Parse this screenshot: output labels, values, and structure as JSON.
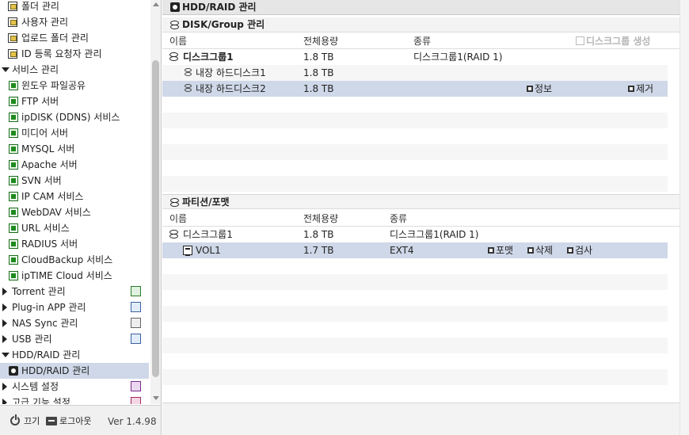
{
  "sidebar": {
    "items": [
      {
        "label": "폴더 관리",
        "icon": "folder-icon"
      },
      {
        "label": "사용자 관리",
        "icon": "folder-icon"
      },
      {
        "label": "업로드 폴더 관리",
        "icon": "folder-icon"
      },
      {
        "label": "ID 등록 요청자 관리",
        "icon": "folder-icon"
      },
      {
        "label": "서비스 관리",
        "icon": "expanded-arrow"
      },
      {
        "label": "윈도우 파일공유",
        "icon": "service-icon"
      },
      {
        "label": "FTP 서버",
        "icon": "service-icon"
      },
      {
        "label": "ipDISK (DDNS) 서비스",
        "icon": "service-icon"
      },
      {
        "label": "미디어 서버",
        "icon": "service-icon"
      },
      {
        "label": "MYSQL 서버",
        "icon": "service-icon"
      },
      {
        "label": "Apache 서버",
        "icon": "service-icon"
      },
      {
        "label": "SVN 서버",
        "icon": "service-icon"
      },
      {
        "label": "IP CAM 서비스",
        "icon": "service-icon"
      },
      {
        "label": "WebDAV 서비스",
        "icon": "service-icon"
      },
      {
        "label": "URL 서비스",
        "icon": "service-icon"
      },
      {
        "label": "RADIUS 서버",
        "icon": "service-icon"
      },
      {
        "label": "CloudBackup 서비스",
        "icon": "service-icon"
      },
      {
        "label": "ipTIME Cloud 서비스",
        "icon": "service-icon"
      },
      {
        "label": "Torrent 관리",
        "icon": "collapsed-arrow"
      },
      {
        "label": "Plug-in APP 관리",
        "icon": "collapsed-arrow"
      },
      {
        "label": "NAS Sync 관리",
        "icon": "collapsed-arrow"
      },
      {
        "label": "USB 관리",
        "icon": "collapsed-arrow"
      },
      {
        "label": "HDD/RAID 관리",
        "icon": "expanded-arrow"
      },
      {
        "label": "HDD/RAID 관리",
        "icon": "hdd-icon"
      },
      {
        "label": "시스템 설정",
        "icon": "collapsed-arrow"
      },
      {
        "label": "고급 기능 설정",
        "icon": "collapsed-arrow"
      }
    ],
    "footer": {
      "power_label": "끄기",
      "logout_label": "로그아웃",
      "version": "Ver 1.4.98"
    }
  },
  "main": {
    "title": "HDD/RAID 관리",
    "disk_panel": {
      "title": "DISK/Group 관리",
      "create_label": "디스크그룹 생성",
      "columns": [
        "이름",
        "전체용량",
        "종류"
      ],
      "rows": [
        {
          "name": "디스크그룹1",
          "capacity": "1.8 TB",
          "type": "디스크그룹1(RAID 1)"
        },
        {
          "name": "내장 하드디스크1",
          "capacity": "1.8 TB",
          "type": ""
        },
        {
          "name": "내장 하드디스크2",
          "capacity": "1.8 TB",
          "type": "",
          "action_info": "정보",
          "action_remove": "제거"
        }
      ]
    },
    "partition_panel": {
      "title": "파티션/포맷",
      "columns": [
        "이름",
        "전체용량",
        "종류"
      ],
      "rows": [
        {
          "name": "디스크그룹1",
          "capacity": "1.8 TB",
          "type": "디스크그룹1(RAID 1)"
        },
        {
          "name": "VOL1",
          "capacity": "1.7 TB",
          "type": "EXT4",
          "action_format": "포맷",
          "action_delete": "삭제",
          "action_check": "검사"
        }
      ]
    }
  },
  "colors": {
    "selection": "#cfd8e8",
    "header_bg": "#e6e6e6"
  }
}
